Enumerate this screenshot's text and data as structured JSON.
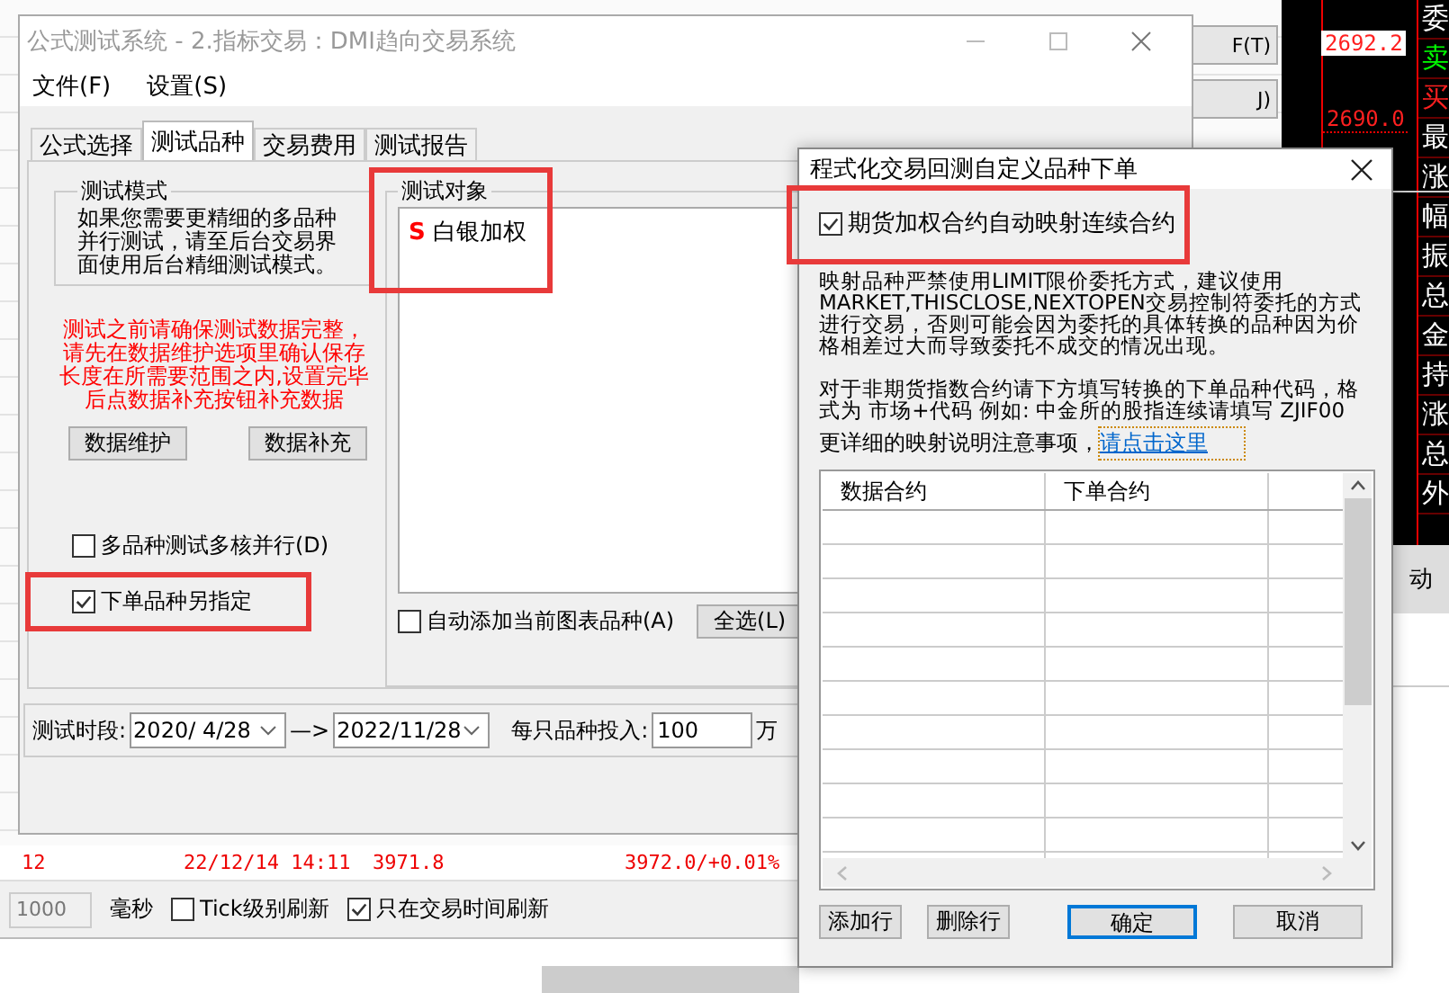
{
  "background": {
    "side_buttons": [
      "F(T)",
      "J)"
    ],
    "price_labels": [
      {
        "text": "2692.2",
        "kind": "boxed"
      },
      {
        "text": "2690.0",
        "kind": "plain"
      }
    ],
    "side_labels": [
      {
        "text": "委",
        "kind": "plain"
      },
      {
        "text": "卖",
        "kind": "sell"
      },
      {
        "text": "买",
        "kind": "buy"
      },
      {
        "text": "最",
        "kind": "plain"
      },
      {
        "text": "涨",
        "kind": "plain"
      },
      {
        "text": "幅",
        "kind": "plain"
      },
      {
        "text": "振",
        "kind": "plain"
      },
      {
        "text": "总",
        "kind": "plain"
      },
      {
        "text": "金",
        "kind": "plain"
      },
      {
        "text": "持",
        "kind": "plain"
      },
      {
        "text": "涨",
        "kind": "plain"
      },
      {
        "text": "总",
        "kind": "plain"
      },
      {
        "text": "外",
        "kind": "plain"
      }
    ],
    "side_tab": "动",
    "last_row": [
      "12",
      "22/12/14 14:11",
      "3971.8",
      "3972.0/+0.01%"
    ],
    "refresh_interval": "1000",
    "interval_unit": "毫秒",
    "options": [
      {
        "label": "Tick级别刷新",
        "checked": false
      },
      {
        "label": "只在交易时间刷新",
        "checked": true
      }
    ]
  },
  "main_window": {
    "title": "公式测试系统 - 2.指标交易：DMI趋向交易系统",
    "menu": [
      "文件(F)",
      "设置(S)"
    ],
    "tabs": [
      {
        "label": "公式选择",
        "selected": false
      },
      {
        "label": "测试品种",
        "selected": true
      },
      {
        "label": "交易费用",
        "selected": false
      },
      {
        "label": "测试报告",
        "selected": false
      }
    ],
    "test_mode": {
      "title": "测试模式",
      "text": "如果您需要更精细的多品种并行测试，请至后台交易界面使用后台精细测试模式。"
    },
    "warning": "测试之前请确保测试数据完整，请先在数据维护选项里确认保存长度在所需要范围之内,设置完毕后点数据补充按钮补充数据",
    "buttons": [
      "数据维护",
      "数据补充"
    ],
    "options": [
      {
        "label": "多品种测试多核并行(D)",
        "checked": false,
        "highlighted": false
      },
      {
        "label": "下单品种另指定",
        "checked": true,
        "highlighted": true
      }
    ],
    "test_objects": {
      "title": "测试对象",
      "highlighted": true,
      "items": [
        {
          "marker": "S",
          "name": "白银加权"
        }
      ]
    },
    "auto_add": {
      "label": "自动添加当前图表品种(A)",
      "checked": false
    },
    "select_all": "全选(L)",
    "period": {
      "label": "测试时段:",
      "start": "2020/ 4/28",
      "arrow": "—>",
      "end": "2022/11/28"
    },
    "investment": {
      "label": "每只品种投入:",
      "value": "100",
      "unit": "万"
    }
  },
  "dialog": {
    "title": "程式化交易回测自定义品种下单",
    "mapping": {
      "label": "期货加权合约自动映射连续合约",
      "checked": true,
      "highlighted": true
    },
    "notes": [
      "映射品种严禁使用LIMIT限价委托方式，建议使用MARKET,THISCLOSE,NEXTOPEN交易控制符委托的方式进行交易，否则可能会因为委托的具体转换的品种因为价格相差过大而导致委托不成交的情况出现。",
      "对于非期货指数合约请下方填写转换的下单品种代码，格式为 市场+代码 例如: 中金所的股指连续请填写 ZJIF00"
    ],
    "more_text": "更详细的映射说明注意事项，",
    "link": "请点击这里",
    "columns": [
      "数据合约",
      "下单合约"
    ],
    "buttons": [
      {
        "label": "添加行",
        "kind": "normal"
      },
      {
        "label": "删除行",
        "kind": "normal"
      },
      {
        "label": "确定",
        "kind": "default"
      },
      {
        "label": "取消",
        "kind": "normal"
      }
    ]
  }
}
